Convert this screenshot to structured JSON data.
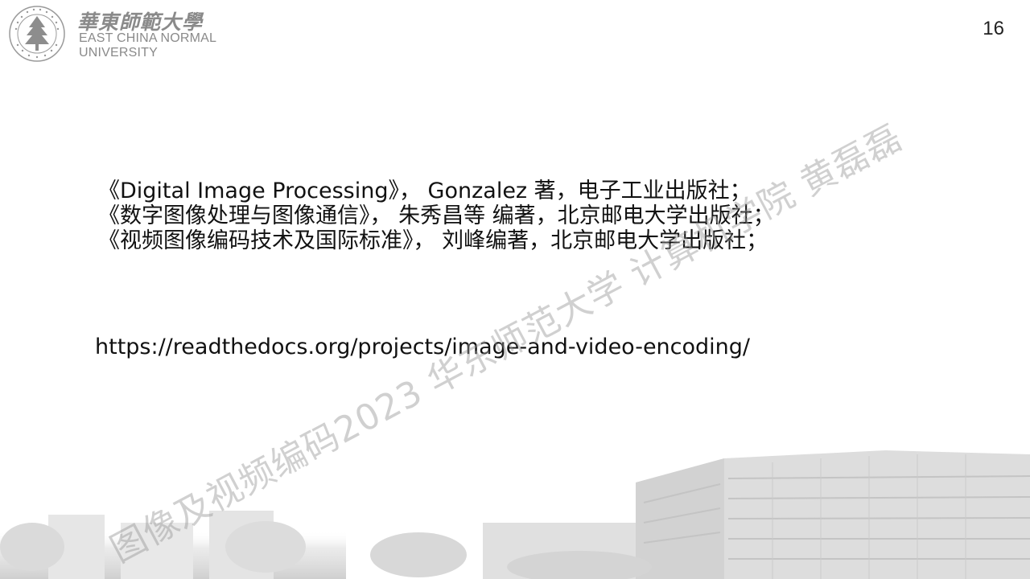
{
  "header": {
    "logo_cn": "華東師範大學",
    "logo_en_line1": "EAST CHINA NORMAL",
    "logo_en_line2": "UNIVERSITY",
    "seal_text": "EAST CHINA NORMAL UNIVERSITY"
  },
  "page_number": "16",
  "references": [
    "《Digital Image Processing》， Gonzalez 著，电子工业出版社；",
    "《数字图像处理与图像通信》， 朱秀昌等 编著，北京邮电大学出版社；",
    "《视频图像编码技术及国际标准》， 刘峰编著，北京邮电大学出版社；"
  ],
  "url": "https://readthedocs.org/projects/image-and-video-encoding/",
  "watermark": "图像及视频编码2023 华东师范大学 计算机学院 黄磊磊",
  "colors": {
    "logo_gray": "#8a8a8a",
    "text": "#111111",
    "watermark": "#969696",
    "campus": "#d9d9d9"
  }
}
